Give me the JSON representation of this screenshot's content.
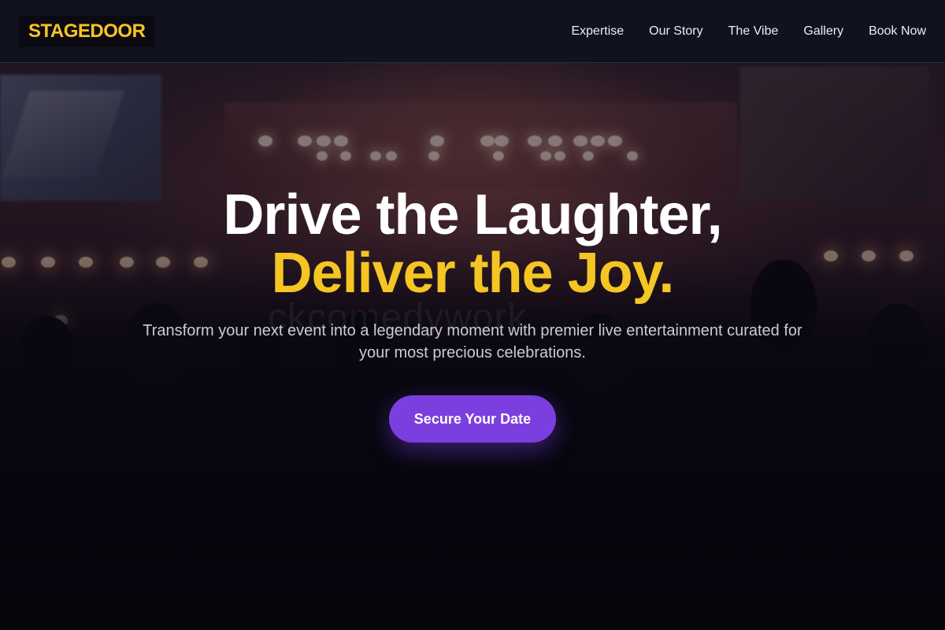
{
  "brand": {
    "logo_text": "STAGEDOOR"
  },
  "nav": {
    "items": [
      {
        "label": "Expertise"
      },
      {
        "label": "Our Story"
      },
      {
        "label": "The Vibe"
      },
      {
        "label": "Gallery"
      },
      {
        "label": "Book Now"
      }
    ]
  },
  "hero": {
    "headline_line1": "Drive the Laughter,",
    "headline_line2": "Deliver the Joy.",
    "ghost_text": "ckcomedywork",
    "subtitle": "Transform your next event into a legendary moment with premier live entertainment curated for your most precious celebrations.",
    "cta_label": "Secure Your Date"
  },
  "colors": {
    "accent_gold": "#f5c523",
    "accent_purple": "#7b3fe0",
    "nav_bg": "#10121f",
    "page_bg": "#07060f"
  }
}
